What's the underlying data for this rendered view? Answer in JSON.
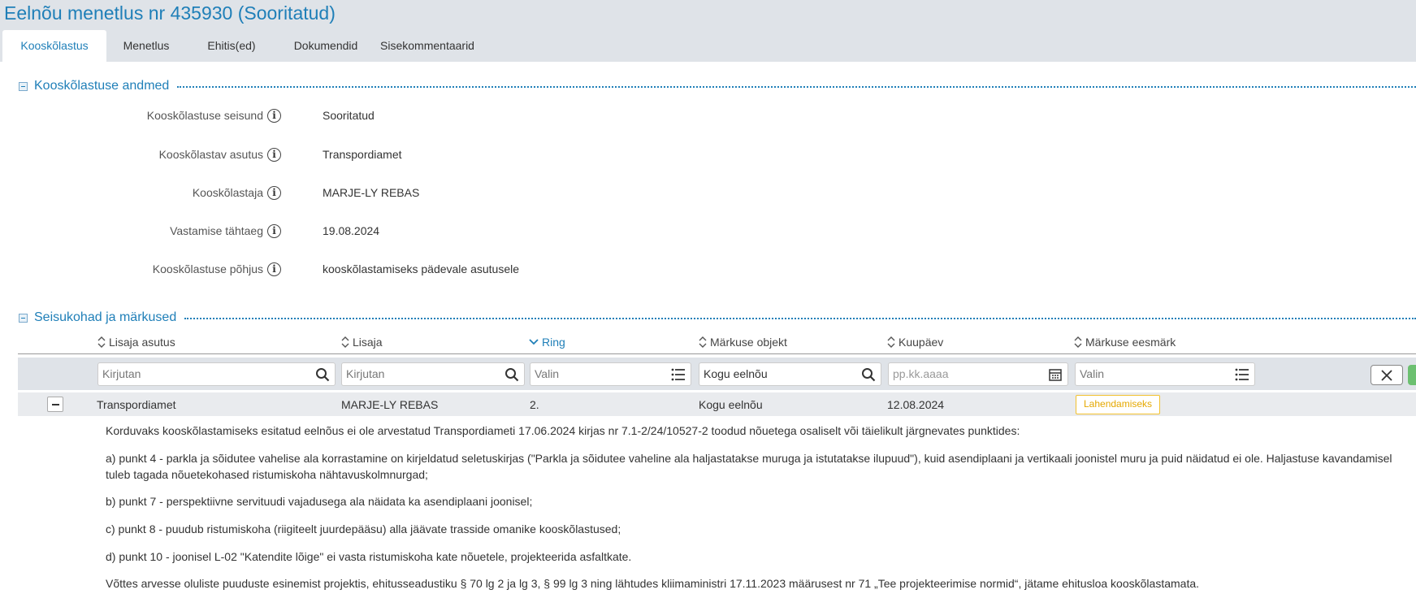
{
  "header": {
    "title": "Eelnõu menetlus nr 435930 (Sooritatud)"
  },
  "tabs": [
    {
      "label": "Kooskõlastus"
    },
    {
      "label": "Menetlus"
    },
    {
      "label": "Ehitis(ed)"
    },
    {
      "label": "Dokumendid"
    },
    {
      "label": "Sisekommentaarid"
    }
  ],
  "details": {
    "title": "Kooskõlastuse andmed",
    "fields": [
      {
        "label": "Kooskõlastuse seisund",
        "value": "Sooritatud"
      },
      {
        "label": "Kooskõlastav asutus",
        "value": "Transpordiamet"
      },
      {
        "label": "Kooskõlastaja",
        "value": "MARJE-LY REBAS"
      },
      {
        "label": "Vastamise tähtaeg",
        "value": "19.08.2024"
      },
      {
        "label": "Kooskõlastuse põhjus",
        "value": "kooskõlastamiseks pädevale asutusele"
      }
    ]
  },
  "remarks": {
    "title": "Seisukohad ja märkused",
    "columns": [
      {
        "label": "Lisaja asutus"
      },
      {
        "label": "Lisaja"
      },
      {
        "label": "Ring"
      },
      {
        "label": "Märkuse objekt"
      },
      {
        "label": "Kuupäev"
      },
      {
        "label": "Märkuse eesmärk"
      }
    ],
    "filters": {
      "agency": "Kirjutan",
      "author": "Kirjutan",
      "round": "Valin",
      "object": "Kogu eelnõu",
      "date_placeholder": "pp.kk.aaaa",
      "purpose": "Valin"
    },
    "row": {
      "agency": "Transpordiamet",
      "author": "MARJE-LY REBAS",
      "round": "2.",
      "object": "Kogu eelnõu",
      "date": "12.08.2024",
      "purpose_badge": "Lahendamiseks"
    },
    "comment": [
      "Korduvaks kooskõlastamiseks esitatud eelnõus ei ole arvestatud Transpordiameti 17.06.2024 kirjas nr 7.1-2/24/10527-2 toodud nõuetega osaliselt või täielikult järgnevates punktides:",
      "a) punkt 4 - parkla ja sõidutee vahelise ala korrastamine on kirjeldatud seletuskirjas (\"Parkla ja sõidutee vaheline ala haljastatakse muruga ja istutatakse ilupuud\"), kuid asendiplaani ja vertikaali joonistel muru ja puid näidatud ei ole. Haljastuse kavandamisel tuleb tagada nõuetekohased ristumiskoha nähtavuskolmnurgad;",
      "b) punkt 7 - perspektiivne servituudi vajadusega ala näidata ka asendiplaani joonisel;",
      "c) punkt 8 - puudub ristumiskoha (riigiteelt juurdepääsu) alla jäävate trasside omanike kooskõlastused;",
      "d) punkt 10 - joonisel L-02 \"Katendite lõige\" ei vasta ristumiskoha kate nõuetele, projekteerida asfaltkate.",
      "Võttes arvesse oluliste puuduste esinemist projektis, ehitusseadustiku § 70 lg 2 ja lg 3, § 99 lg 3 ning lähtudes kliimaministri 17.11.2023 määrusest nr 71 „Tee projekteerimise normid“, jätame ehitusloa kooskõlastamata."
    ]
  },
  "icons": {
    "info": "info-icon",
    "search": "search-icon",
    "list": "list-icon",
    "calendar": "calendar-icon",
    "sort": "sort-icon",
    "close": "close-icon"
  },
  "colors": {
    "accent": "#1f7fb8",
    "badge": "#f2c12e",
    "header_bg": "#dfe3e8"
  }
}
